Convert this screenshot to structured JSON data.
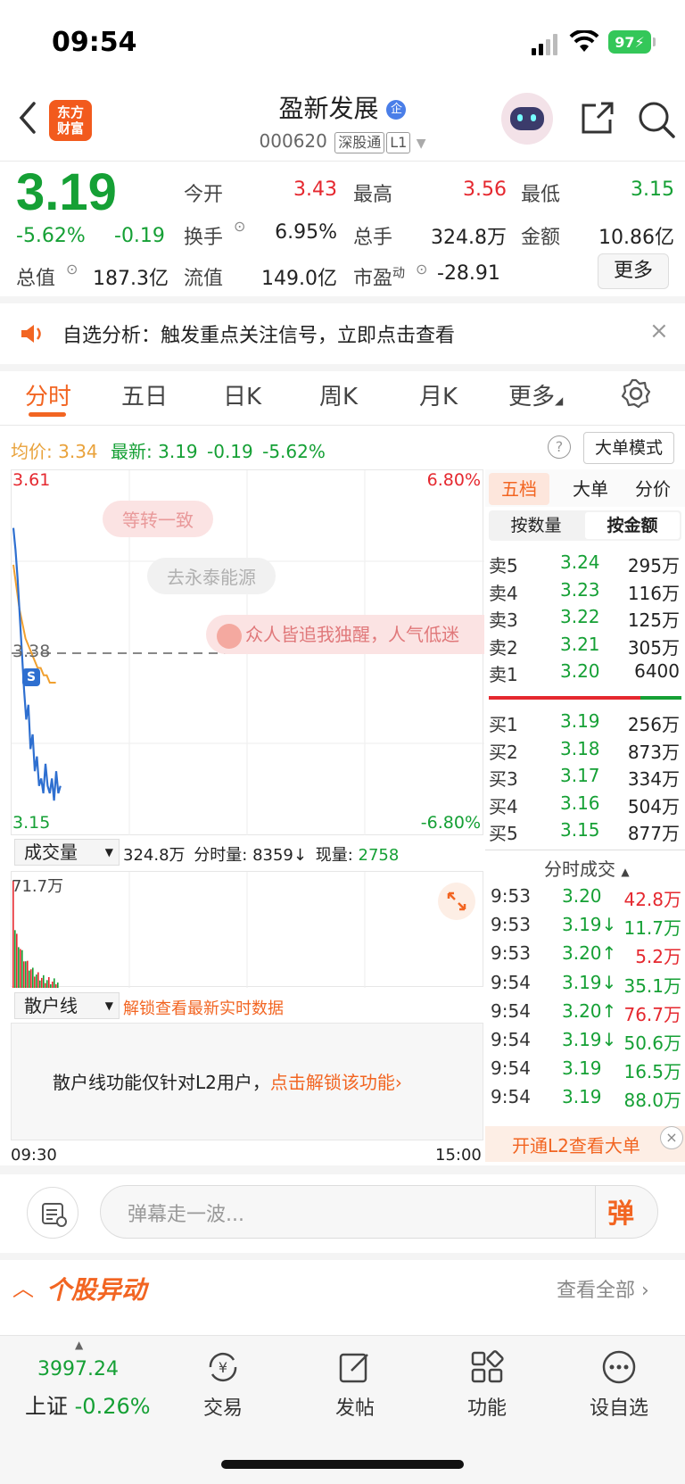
{
  "status": {
    "time": "09:54",
    "battery": "97"
  },
  "header": {
    "brand_line1": "东方",
    "brand_line2": "财富",
    "title": "盈新发展",
    "badge": "企",
    "code": "000620",
    "tag1": "深股通",
    "tag2": "L1"
  },
  "quote": {
    "price": "3.19",
    "pct": "-5.62%",
    "change": "-0.19",
    "open_label": "今开",
    "open": "3.43",
    "high_label": "最高",
    "high": "3.56",
    "low_label": "最低",
    "low": "3.15",
    "turnover_label": "换手",
    "turnover": "6.95%",
    "volume_label": "总手",
    "volume": "324.8万",
    "amount_label": "金额",
    "amount": "10.86亿",
    "mcap_label": "总值",
    "mcap": "187.3亿",
    "float_label": "流值",
    "float": "149.0亿",
    "pe_label": "市盈",
    "pe_sup": "动",
    "pe": "-28.91",
    "more": "更多"
  },
  "notice": {
    "text": "自选分析：触发重点关注信号，立即点击查看"
  },
  "tabs": [
    "分时",
    "五日",
    "日K",
    "周K",
    "月K",
    "更多"
  ],
  "info_bar": {
    "avg_label": "均价:",
    "avg": "3.34",
    "latest_label": "最新:",
    "latest": "3.19",
    "chg": "-0.19",
    "pct": "-5.62%",
    "mode_btn": "大单模式"
  },
  "chart": {
    "ymax": "3.61",
    "ymin": "3.15",
    "pct_max": "6.80%",
    "pct_min": "-6.80%",
    "ref": "3.38",
    "danmaku1": "等转一致",
    "danmaku2": "去永泰能源",
    "danmaku3": "众人皆追我独醒，人气低迷",
    "s_marker": "S",
    "vol_selector": "成交量",
    "vol_total": "324.8万",
    "vol_min_label": "分时量:",
    "vol_min": "8359",
    "vol_now_label": "现量:",
    "vol_now": "2758",
    "vol_max": "71.7万",
    "retail_selector": "散户线",
    "retail_unlock": "解锁查看最新实时数据",
    "retail_msg": "散户线功能仅针对L2用户，",
    "retail_link": "点击解锁该功能",
    "time_start": "09:30",
    "time_end": "15:00"
  },
  "chart_data": {
    "type": "line",
    "title": "",
    "y_range": [
      3.15,
      3.61
    ],
    "ref_price": 3.38,
    "series": [
      {
        "name": "",
        "values": [
          3.55,
          3.52,
          3.48,
          3.43,
          3.38,
          3.33,
          3.29,
          3.31,
          3.25,
          3.27,
          3.22,
          3.24,
          3.2,
          3.21,
          3.19,
          3.23,
          3.2,
          3.19,
          3.21,
          3.18,
          3.22,
          3.19,
          3.2
        ]
      },
      {
        "name": "",
        "values": [
          3.5,
          3.47,
          3.44,
          3.42,
          3.4,
          3.39,
          3.38,
          3.37,
          3.36,
          3.36,
          3.35,
          3.35,
          3.34,
          3.34,
          3.34
        ]
      }
    ]
  },
  "order_book": {
    "tabs": [
      "五档",
      "大单",
      "分价"
    ],
    "subtabs": [
      "按数量",
      "按金额"
    ],
    "asks": [
      {
        "label": "卖5",
        "price": "3.24",
        "amount": "295万"
      },
      {
        "label": "卖4",
        "price": "3.23",
        "amount": "116万"
      },
      {
        "label": "卖3",
        "price": "3.22",
        "amount": "125万"
      },
      {
        "label": "卖2",
        "price": "3.21",
        "amount": "305万"
      },
      {
        "label": "卖1",
        "price": "3.20",
        "amount": "6400"
      }
    ],
    "bids": [
      {
        "label": "买1",
        "price": "3.19",
        "amount": "256万"
      },
      {
        "label": "买2",
        "price": "3.18",
        "amount": "873万"
      },
      {
        "label": "买3",
        "price": "3.17",
        "amount": "334万"
      },
      {
        "label": "买4",
        "price": "3.16",
        "amount": "504万"
      },
      {
        "label": "买5",
        "price": "3.15",
        "amount": "877万"
      }
    ]
  },
  "ticks": {
    "title": "分时成交",
    "rows": [
      {
        "time": "9:53",
        "price": "3.20",
        "arrow": "",
        "amount": "42.8万",
        "pc": "green",
        "ac": "red"
      },
      {
        "time": "9:53",
        "price": "3.19",
        "arrow": "↓",
        "amount": "11.7万",
        "pc": "green",
        "ac": "green"
      },
      {
        "time": "9:53",
        "price": "3.20",
        "arrow": "↑",
        "amount": "5.2万",
        "pc": "green",
        "ac": "red"
      },
      {
        "time": "9:54",
        "price": "3.19",
        "arrow": "↓",
        "amount": "35.1万",
        "pc": "green",
        "ac": "green"
      },
      {
        "time": "9:54",
        "price": "3.20",
        "arrow": "↑",
        "amount": "76.7万",
        "pc": "green",
        "ac": "red"
      },
      {
        "time": "9:54",
        "price": "3.19",
        "arrow": "↓",
        "amount": "50.6万",
        "pc": "green",
        "ac": "green"
      },
      {
        "time": "9:54",
        "price": "3.19",
        "arrow": "",
        "amount": "16.5万",
        "pc": "green",
        "ac": "green"
      },
      {
        "time": "9:54",
        "price": "3.19",
        "arrow": "",
        "amount": "88.0万",
        "pc": "green",
        "ac": "green"
      }
    ],
    "l2_banner": "开通L2查看大单"
  },
  "danmu_input": {
    "placeholder": "弹幕走一波...",
    "send": "弹"
  },
  "abnormal": {
    "title": "个股异动",
    "view_all": "查看全部"
  },
  "bottom_nav": {
    "index_value": "3997.24",
    "index_name": "上证",
    "index_pct": "-0.26%",
    "items": [
      "交易",
      "发帖",
      "功能",
      "设自选"
    ]
  },
  "colors": {
    "up": "#e5282f",
    "down": "#15a035",
    "accent": "#f26522"
  }
}
